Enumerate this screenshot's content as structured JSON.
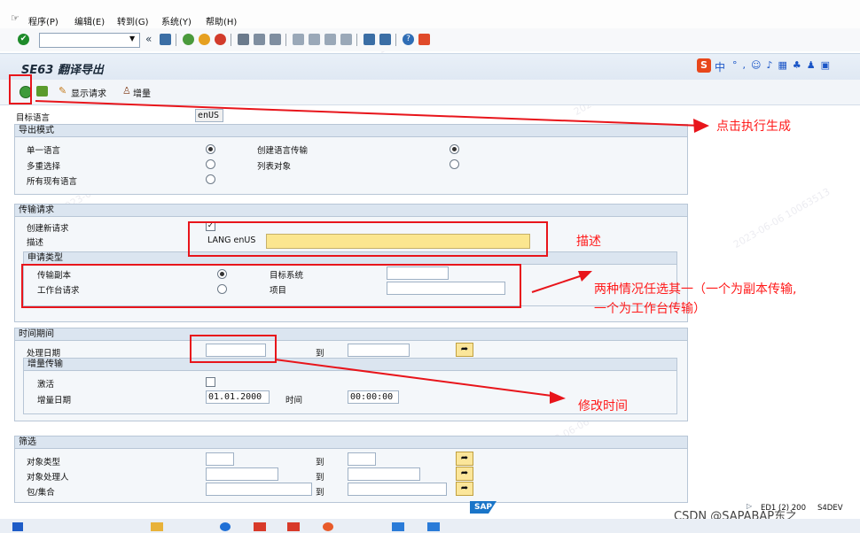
{
  "menu": [
    "程序(P)",
    "编辑(E)",
    "转到(G)",
    "系统(Y)",
    "帮助(H)"
  ],
  "title": "SE63 翻译导出",
  "app_toolbar": {
    "show_request": "显示请求",
    "delta": "增量"
  },
  "ime": "中",
  "target_language": {
    "label": "目标语言",
    "value": "enUS"
  },
  "export_mode": {
    "title": "导出模式",
    "options": [
      "单一语言",
      "多重选择",
      "所有现有语言"
    ],
    "right_options": [
      "创建语言传输",
      "列表对象"
    ]
  },
  "transport": {
    "title": "传输请求",
    "create_new": "创建新请求",
    "description_label": "描述",
    "description_prefix": "LANG enUS",
    "request_type_title": "申请类型",
    "copy_transport": "传输副本",
    "workbench_request": "工作台请求",
    "target_system": "目标系统",
    "project": "项目"
  },
  "period": {
    "title": "时间期间",
    "processing_date": "处理日期",
    "to": "到",
    "delta_title": "增量传输",
    "activate": "激活",
    "delta_date": "增量日期",
    "delta_date_value": "01.01.2000",
    "time": "时间",
    "time_value": "00:00:00"
  },
  "filter": {
    "title": "筛选",
    "object_type": "对象类型",
    "object_processor": "对象处理人",
    "package": "包/集合",
    "to": "到"
  },
  "annotations": {
    "execute": "点击执行生成",
    "description": "描述",
    "choose_line1": "两种情况任选其一（一个为副本传输,",
    "choose_line2": "一个为工作台传输）",
    "modify_time": "修改时间"
  },
  "status": {
    "system": "ED1 (2) 200",
    "server": "S4DEV"
  },
  "sap_logo": "SAP",
  "csdn": "CSDN @SAPABAP东之",
  "watermark": "2023-06-06 10063513",
  "colors": {
    "accent_red": "#e8151b",
    "title_bg": "#dfe8f3",
    "f4_yellow": "#fbe69a"
  }
}
